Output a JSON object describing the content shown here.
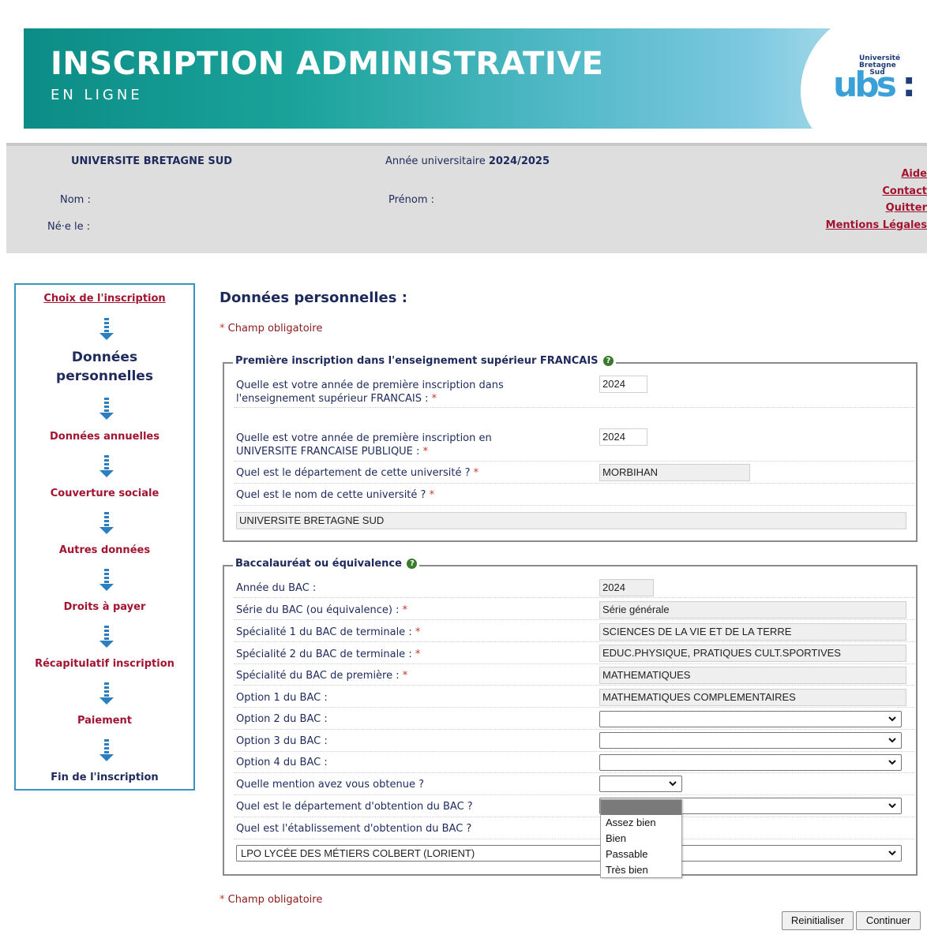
{
  "banner": {
    "title": "INSCRIPTION ADMINISTRATIVE",
    "subtitle": "EN LIGNE",
    "logo_small": "Université Bretagne Sud",
    "logo_text": "ubs",
    "logo_colon": ":"
  },
  "header": {
    "university": "UNIVERSITE BRETAGNE SUD",
    "year_label": "Année universitaire",
    "year_value": "2024/2025",
    "nom_label": "Nom :",
    "prenom_label": "Prénom :",
    "ne_label": "Né·e le :",
    "links": [
      "Aide",
      "Contact",
      "Quitter",
      "Mentions Légales"
    ]
  },
  "steps": [
    {
      "label": "Choix de l'inscription"
    },
    {
      "label": "Données personnelles"
    },
    {
      "label": "Données annuelles"
    },
    {
      "label": "Couverture sociale"
    },
    {
      "label": "Autres données"
    },
    {
      "label": "Droits à payer"
    },
    {
      "label": "Récapitulatif inscription"
    },
    {
      "label": "Paiement"
    },
    {
      "label": "Fin de l'inscription"
    }
  ],
  "page": {
    "title": "Données personnelles :",
    "required_note": "Champ obligatoire",
    "star": "*"
  },
  "section1": {
    "legend": "Première inscription dans l'enseignement supérieur FRANCAIS",
    "q1_line1": "Quelle est votre année de première inscription dans",
    "q1_line2": "l'enseignement supérieur FRANCAIS :",
    "q1_value": "2024",
    "q2_line1": "Quelle est votre année de première inscription en",
    "q2_line2": "UNIVERSITE FRANCAISE PUBLIQUE :",
    "q2_value": "2024",
    "q3": "Quel est le département de cette université ?",
    "q3_value": "MORBIHAN",
    "q4": "Quel est le nom de cette université ?",
    "q4_value": "UNIVERSITE BRETAGNE SUD"
  },
  "section2": {
    "legend": "Baccalauréat ou équivalence",
    "rows": [
      {
        "label": "Année du BAC :",
        "value": "2024",
        "required": false
      },
      {
        "label": "Série du BAC (ou équivalence) :",
        "value": "Série générale",
        "required": true
      },
      {
        "label": "Spécialité 1 du BAC de terminale :",
        "value": "SCIENCES DE LA VIE ET DE LA TERRE",
        "required": true
      },
      {
        "label": "Spécialité 2 du BAC de terminale :",
        "value": "EDUC.PHYSIQUE,  PRATIQUES CULT.SPORTIVES",
        "required": true
      },
      {
        "label": "Spécialité du BAC de première :",
        "value": "MATHEMATIQUES",
        "required": true
      },
      {
        "label": "Option 1 du BAC :",
        "value": "MATHEMATIQUES COMPLEMENTAIRES",
        "required": false
      },
      {
        "label": "Option 2 du BAC :",
        "value": "",
        "required": false
      },
      {
        "label": "Option 3 du BAC :",
        "value": "",
        "required": false
      },
      {
        "label": "Option 4 du BAC :",
        "value": "",
        "required": false
      },
      {
        "label": "Quelle mention avez vous obtenue ?",
        "value": "",
        "required": false
      },
      {
        "label": "Quel est le département d'obtention du BAC ?",
        "value": "",
        "required": false
      },
      {
        "label": "Quel est l'établissement d'obtention du BAC ?",
        "value": "",
        "required": false
      }
    ],
    "etablissement_value": "LPO LYCÉE DES MÉTIERS COLBERT (LORIENT)"
  },
  "mention_dropdown": {
    "options": [
      "",
      "Assez bien",
      "Bien",
      "Passable",
      "Très bien"
    ]
  },
  "buttons": {
    "reset": "Reinitialiser",
    "continue": "Continuer"
  },
  "colors": {
    "link_red": "#a2142f",
    "navy": "#1d2a5b",
    "sidebar_border": "#3c93c0",
    "arrow_blue": "#2b7fc0"
  },
  "icons": {
    "help": "question-circle-icon",
    "arrow": "arrow-down-icon",
    "chevron": "chevron-down-icon"
  }
}
